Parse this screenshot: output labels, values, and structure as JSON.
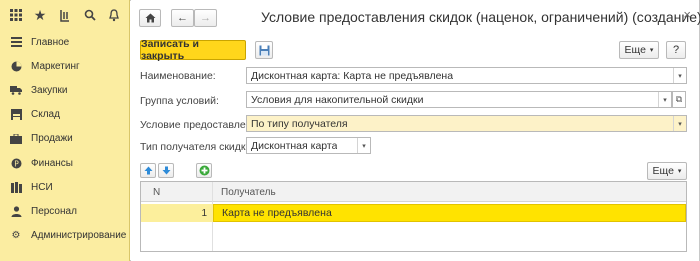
{
  "app": {
    "window_title": "Условие предоставления скидок (наценок, ограничений) (создание) *"
  },
  "sidebar": {
    "toolbar_icons": [
      "apps-grid-icon",
      "star-icon",
      "history-icon",
      "search-icon",
      "bell-icon"
    ],
    "items": [
      {
        "label": "Главное",
        "icon": "menu-lines-icon"
      },
      {
        "label": "Маркетинг",
        "icon": "pie-chart-icon"
      },
      {
        "label": "Закупки",
        "icon": "truck-icon"
      },
      {
        "label": "Склад",
        "icon": "warehouse-icon"
      },
      {
        "label": "Продажи",
        "icon": "briefcase-icon"
      },
      {
        "label": "Финансы",
        "icon": "coin-icon"
      },
      {
        "label": "НСИ",
        "icon": "books-icon"
      },
      {
        "label": "Персонал",
        "icon": "person-icon"
      },
      {
        "label": "Администрирование",
        "icon": "gear-icon"
      }
    ]
  },
  "toolbar": {
    "save_close_label": "Записать и закрыть",
    "more_label": "Еще",
    "help_label": "?"
  },
  "form": {
    "name_label": "Наименование:",
    "name_value": "Дисконтная карта: Карта не предъявлена",
    "group_label": "Группа условий:",
    "group_value": "Условия для накопительной скидки",
    "condition_label": "Условие предоставления:",
    "condition_value": "По типу получателя",
    "recipient_type_label": "Тип получателя скидки:",
    "recipient_type_value": "Дисконтная карта"
  },
  "table": {
    "more_label": "Еще",
    "columns": [
      "N",
      "Получатель"
    ],
    "rows": [
      {
        "n": "1",
        "recipient": "Карта не предъявлена"
      }
    ]
  },
  "colors": {
    "sidebar_bg": "#fbeda1",
    "accent_yellow": "#ffd61b",
    "selected_row": "#ffe300",
    "highlight_field": "#fdf2c8",
    "add_button_green": "#3aa93a",
    "arrow_blue": "#2e8bd8"
  }
}
